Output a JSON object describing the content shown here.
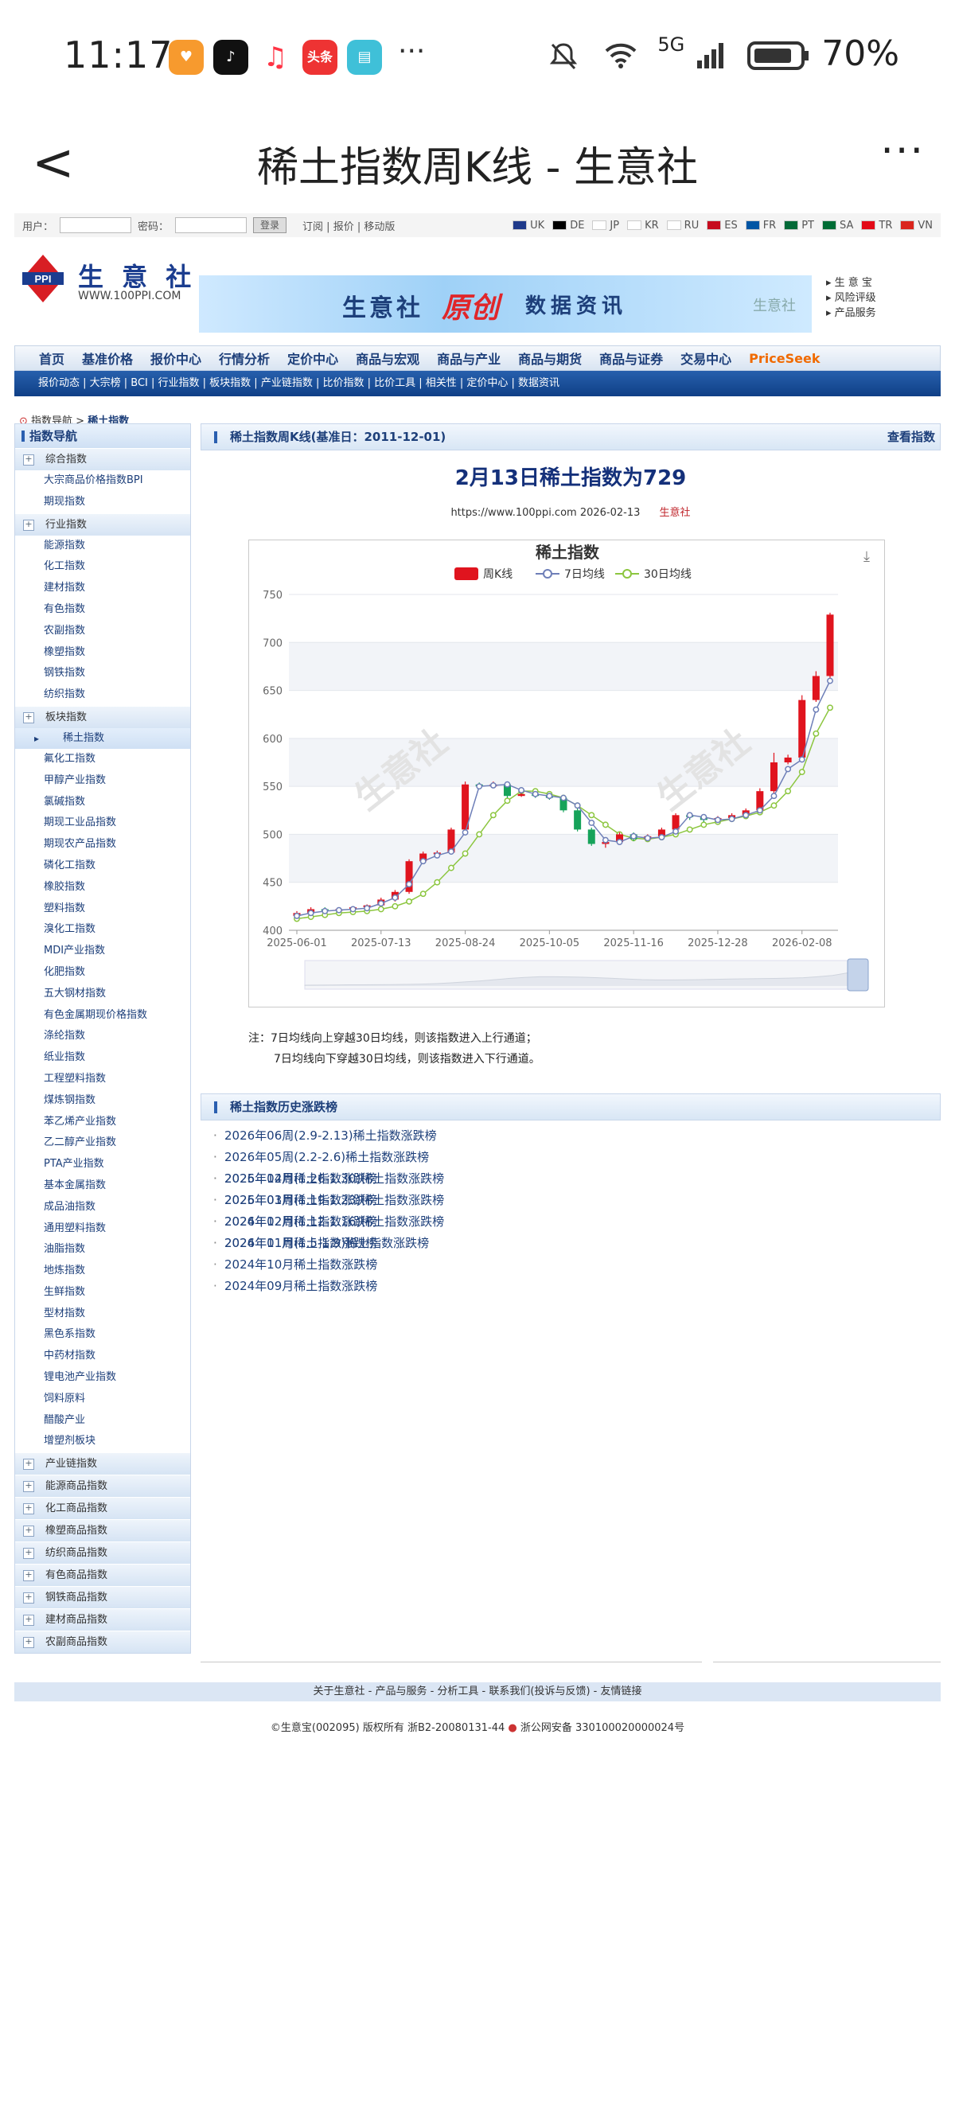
{
  "status_bar": {
    "time": "11:17",
    "network": "5G",
    "battery": "70%",
    "more": "···"
  },
  "nav": {
    "back": "<",
    "title": "稀土指数周K线 - 生意社",
    "more": "···"
  },
  "topbar": {
    "user_label": "用户：",
    "pwd_label": "密码：",
    "login_btn": "登录",
    "links": "订阅 | 报价 | 移动版",
    "langs": [
      "UK",
      "DE",
      "JP",
      "KR",
      "RU",
      "ES",
      "FR",
      "PT",
      "SA",
      "TR",
      "VN"
    ]
  },
  "brand": {
    "name": "生 意 社",
    "url": "WWW.100PPI.COM",
    "logo_text": "PPI",
    "banner": {
      "t1": "生意社",
      "t2": "原创",
      "t3": "数据资讯",
      "t4": "生意社"
    },
    "links": [
      "生 意 宝",
      "风险评级",
      "产品服务"
    ]
  },
  "mainnav": [
    "首页",
    "基准价格",
    "报价中心",
    "行情分析",
    "定价中心",
    "商品与宏观",
    "商品与产业",
    "商品与期货",
    "商品与证券",
    "交易中心",
    "PriceSeek"
  ],
  "subnav": "报价动态 | 大宗榜 | BCI | 行业指数 | 板块指数 | 产业链指数 | 比价指数 | 比价工具 | 相关性 | 定价中心 | 数据资讯",
  "breadcrumb": {
    "root": "指数导航 >",
    "current": "稀土指数"
  },
  "sidebar": {
    "title": "指数导航",
    "group1": "综合指数",
    "group1_items": [
      "大宗商品价格指数BPI",
      "期现指数"
    ],
    "group2": "行业指数",
    "group2_items": [
      "能源指数",
      "化工指数",
      "建材指数",
      "有色指数",
      "农副指数",
      "橡塑指数",
      "钢铁指数",
      "纺织指数"
    ],
    "group3": "板块指数",
    "selected": "稀土指数",
    "group3_items": [
      "氟化工指数",
      "甲醇产业指数",
      "氯碱指数",
      "期现工业品指数",
      "期现农产品指数",
      "磷化工指数",
      "橡胶指数",
      "塑料指数",
      "溴化工指数",
      "MDI产业指数",
      "化肥指数",
      "五大钢材指数",
      "有色金属期现价格指数",
      "涤纶指数",
      "纸业指数",
      "工程塑料指数",
      "煤炼钢指数",
      "苯乙烯产业指数",
      "乙二醇产业指数",
      "PTA产业指数",
      "基本金属指数",
      "成品油指数",
      "通用塑料指数",
      "油脂指数",
      "地炼指数",
      "生鲜指数",
      "型材指数",
      "黑色系指数",
      "中药材指数",
      "锂电池产业指数",
      "饲料原料",
      "醋酸产业",
      "增塑剂板块"
    ],
    "bottom_groups": [
      "产业链指数",
      "能源商品指数",
      "化工商品指数",
      "橡塑商品指数",
      "纺织商品指数",
      "有色商品指数",
      "钢铁商品指数",
      "建材商品指数",
      "农副商品指数"
    ]
  },
  "main": {
    "section_title": "稀土指数周K线(基准日：2011-12-01)",
    "section_link": "查看指数",
    "headline": "2月13日稀土指数为729",
    "source_url": "https://www.100ppi.com 2026-02-13",
    "source_name": "生意社",
    "notes": [
      "注：7日均线向上穿越30日均线，则该指数进入上行通道；",
      "7日均线向下穿越30日均线，则该指数进入下行通道。"
    ],
    "history_title": "稀土指数历史涨跌榜",
    "history_a": [
      "2026年06周(2.9-2.13)稀土指数涨跌榜",
      "2026年05周(2.2-2.6)稀土指数涨跌榜",
      "2026年04周(1.26-1.30)稀土指数涨跌榜",
      "2026年03周(1.19-1.23)稀土指数涨跌榜",
      "2026年02周(1.12-1.16)稀土指数涨跌榜",
      "2026年01周(1.5-1.9)稀土指数涨跌榜"
    ],
    "history_b": [
      "2025年12月稀土指数涨跌榜",
      "2025年01月稀土指数涨跌榜",
      "2024年12月稀土指数涨跌榜",
      "2024年11月稀土指数涨跌榜",
      "2024年10月稀土指数涨跌榜",
      "2024年09月稀土指数涨跌榜"
    ]
  },
  "footer": {
    "links": "关于生意社 - 产品与服务 - 分析工具 - 联系我们(投诉与反馈) - 友情链接",
    "copyright": "©生意宝(002095) 版权所有 浙B2-20080131-44",
    "police": "浙公网安备 330100020000024号"
  },
  "chart_data": {
    "type": "candlestick",
    "title": "稀土指数",
    "legend": [
      "周K线",
      "7日均线",
      "30日均线"
    ],
    "watermark": "生意社",
    "ylim": [
      400,
      750
    ],
    "yticks": [
      400,
      450,
      500,
      550,
      600,
      650,
      700,
      750
    ],
    "xticks": [
      "2025-06-01",
      "2025-07-13",
      "2025-08-24",
      "2025-10-05",
      "2025-11-16",
      "2025-12-28",
      "2026-02-08"
    ],
    "colors": {
      "up": "#e0141e",
      "down": "#16a35a",
      "ma7": "#6e7fb8",
      "ma30": "#8cc63f"
    },
    "candles": [
      [
        415,
        418,
        413,
        420
      ],
      [
        418,
        422,
        416,
        424
      ],
      [
        422,
        421,
        419,
        424
      ],
      [
        421,
        422,
        420,
        424
      ],
      [
        422,
        424,
        421,
        425
      ],
      [
        424,
        426,
        423,
        427
      ],
      [
        426,
        432,
        425,
        434
      ],
      [
        432,
        440,
        430,
        442
      ],
      [
        440,
        472,
        438,
        474
      ],
      [
        472,
        480,
        470,
        482
      ],
      [
        480,
        481,
        478,
        483
      ],
      [
        481,
        505,
        480,
        507
      ],
      [
        505,
        552,
        503,
        555
      ],
      [
        552,
        550,
        548,
        554
      ],
      [
        550,
        552,
        549,
        555
      ],
      [
        552,
        540,
        538,
        554
      ],
      [
        540,
        542,
        539,
        544
      ],
      [
        542,
        540,
        538,
        544
      ],
      [
        540,
        538,
        536,
        542
      ],
      [
        538,
        525,
        523,
        540
      ],
      [
        525,
        505,
        503,
        527
      ],
      [
        505,
        490,
        488,
        507
      ],
      [
        490,
        492,
        486,
        494
      ],
      [
        492,
        500,
        490,
        502
      ],
      [
        500,
        495,
        493,
        502
      ],
      [
        495,
        498,
        493,
        500
      ],
      [
        498,
        505,
        496,
        507
      ],
      [
        505,
        520,
        503,
        522
      ],
      [
        520,
        518,
        515,
        522
      ],
      [
        518,
        515,
        513,
        520
      ],
      [
        515,
        517,
        514,
        519
      ],
      [
        517,
        520,
        515,
        522
      ],
      [
        520,
        525,
        518,
        527
      ],
      [
        525,
        545,
        523,
        548
      ],
      [
        545,
        575,
        543,
        585
      ],
      [
        575,
        580,
        573,
        583
      ],
      [
        580,
        640,
        578,
        645
      ],
      [
        640,
        665,
        638,
        670
      ],
      [
        665,
        729,
        660,
        731
      ]
    ],
    "ma7": [
      415,
      418,
      420,
      421,
      422,
      423,
      428,
      434,
      448,
      472,
      478,
      482,
      502,
      550,
      551,
      552,
      546,
      542,
      540,
      538,
      530,
      512,
      494,
      492,
      498,
      496,
      497,
      503,
      520,
      518,
      515,
      516,
      520,
      525,
      540,
      568,
      578,
      630,
      660
    ],
    "ma30": [
      412,
      414,
      416,
      418,
      419,
      420,
      422,
      425,
      430,
      438,
      450,
      465,
      480,
      500,
      520,
      535,
      545,
      545,
      542,
      538,
      530,
      520,
      510,
      500,
      496,
      495,
      497,
      500,
      505,
      510,
      513,
      516,
      519,
      523,
      530,
      545,
      565,
      605,
      632
    ]
  }
}
